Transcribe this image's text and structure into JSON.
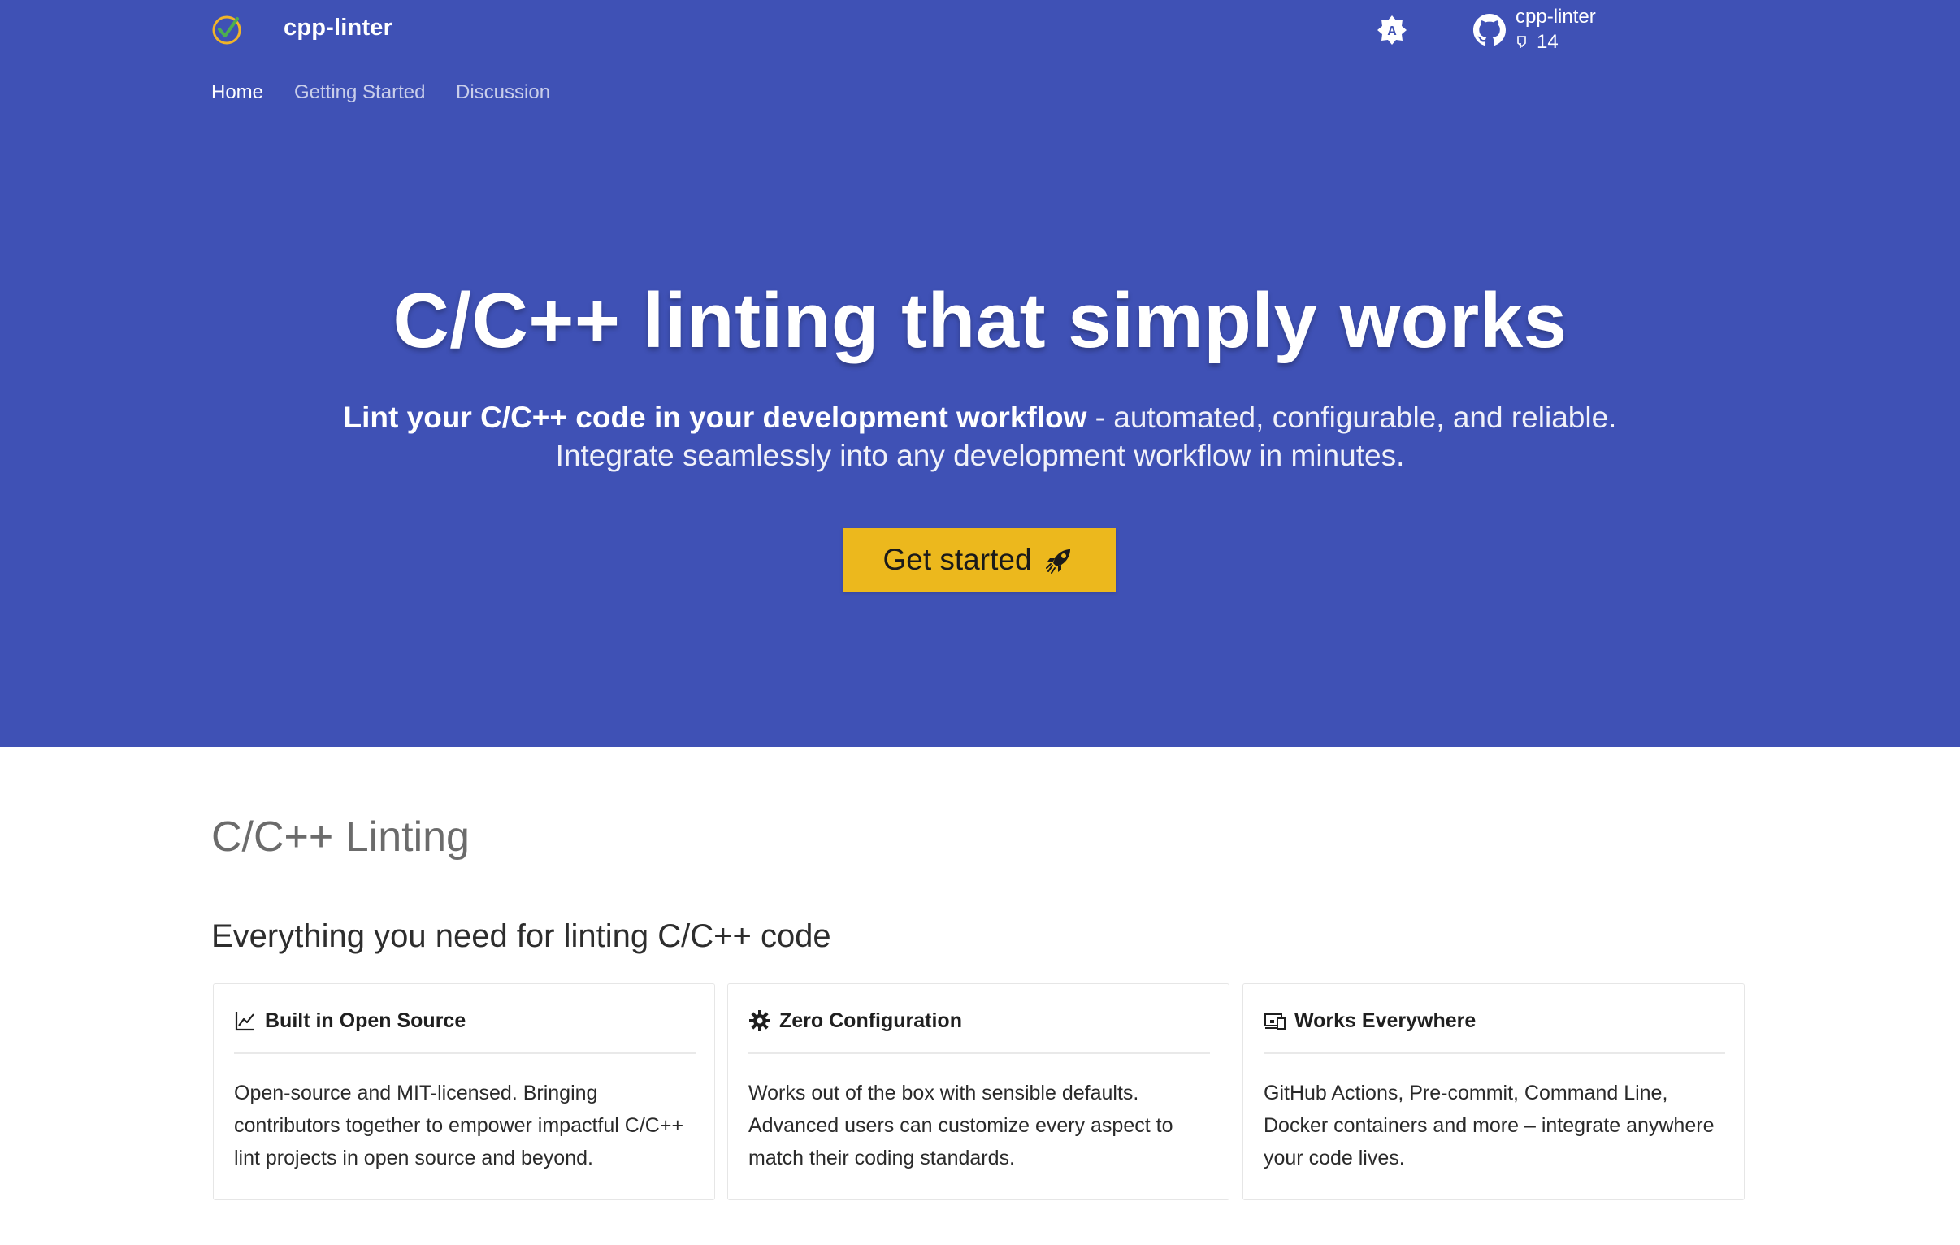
{
  "header": {
    "site_name": "cpp-linter",
    "logo_icon": "check-circle-logo-icon",
    "palette_icon": "brightness-auto-icon",
    "repo": {
      "name": "cpp-linter",
      "stat_icon": "tag-icon",
      "stat_value": "14"
    }
  },
  "tabs": [
    {
      "label": "Home",
      "active": true
    },
    {
      "label": "Getting Started",
      "active": false
    },
    {
      "label": "Discussion",
      "active": false
    }
  ],
  "hero": {
    "title": "C/C++ linting that simply works",
    "subtitle_bold": "Lint your C/C++ code in your development workflow",
    "subtitle_rest": " - automated, configurable, and reliable.",
    "subtitle_line2": "Integrate seamlessly into any development workflow in minutes.",
    "cta_label": "Get started",
    "cta_icon": "rocket-icon",
    "background_color": "#3f51b5",
    "cta_color": "#ecb81d"
  },
  "main": {
    "section_title": "C/C++ Linting",
    "section_subtitle": "Everything you need for linting C/C++ code",
    "cards": [
      {
        "icon": "chart-line-icon",
        "title": "Built in Open Source",
        "body": "Open-source and MIT-licensed. Bringing contributors together to empower impactful C/C++ lint projects in open source and beyond."
      },
      {
        "icon": "gear-icon",
        "title": "Zero Configuration",
        "body": "Works out of the box with sensible defaults. Advanced users can customize every aspect to match their coding standards."
      },
      {
        "icon": "devices-icon",
        "title": "Works Everywhere",
        "body": "GitHub Actions, Pre-commit, Command Line, Docker containers and more – integrate anywhere your code lives."
      }
    ]
  }
}
